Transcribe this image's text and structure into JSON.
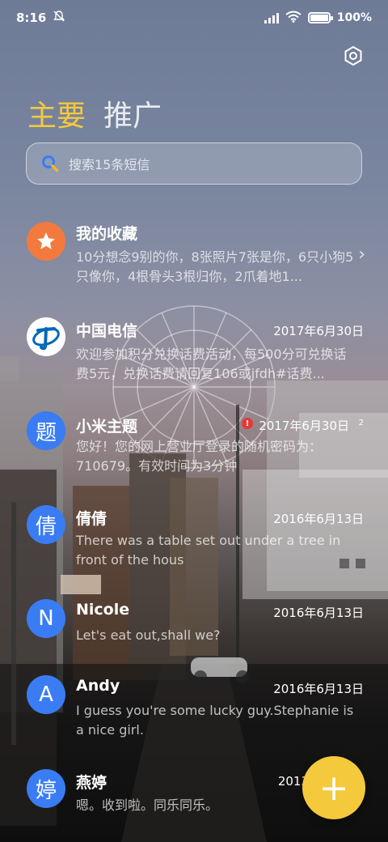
{
  "status_bar": {
    "time": "8:16",
    "battery": "100%"
  },
  "header": {
    "tabs": [
      {
        "label": "主要",
        "active": true
      },
      {
        "label": "推广",
        "active": false
      }
    ]
  },
  "search": {
    "placeholder": "搜索15条短信"
  },
  "conversations": [
    {
      "name": "我的收藏",
      "date": "",
      "preview": "10分想念9别的你，8张照片7张是你，6只小狗5只像你，4根骨头3根归你，2爪着地1...",
      "avatar": "★",
      "avatar_color": "#f27a3e",
      "has_chevron": true
    },
    {
      "name": "中国电信",
      "date": "2017年6月30日",
      "preview": "欢迎参加积分兑换话费活动，每500分可兑换话费5元，兑换话费请回复106或jfdh#话费...",
      "avatar": "china-telecom-logo",
      "avatar_color": "#ffffff"
    },
    {
      "name": "小米主题",
      "date": "2017年6月30日",
      "preview": "您好！您的网上营业厅登录的随机密码为：710679。有效时间为3分钟",
      "avatar": "题",
      "avatar_color": "#3a7cf4",
      "error_badge": "!",
      "count": "2"
    },
    {
      "name": "倩倩",
      "date": "2016年6月13日",
      "preview": "There was a table set out under a tree in front of the hous",
      "avatar": "倩",
      "avatar_color": "#3a7cf4"
    },
    {
      "name": "Nicole",
      "date": "2016年6月13日",
      "preview": "Let's eat out,shall we?",
      "avatar": "N",
      "avatar_color": "#3a7cf4"
    },
    {
      "name": "Andy",
      "date": "2016年6月13日",
      "preview": "I guess you're some lucky guy.Stephanie is a nice girl.",
      "avatar": "A",
      "avatar_color": "#3a7cf4"
    },
    {
      "name": "燕婷",
      "date": "2013",
      "preview": "嗯。收到啦。同乐同乐。",
      "avatar": "婷",
      "avatar_color": "#3a7cf4"
    }
  ],
  "fab": {
    "label": "+"
  }
}
